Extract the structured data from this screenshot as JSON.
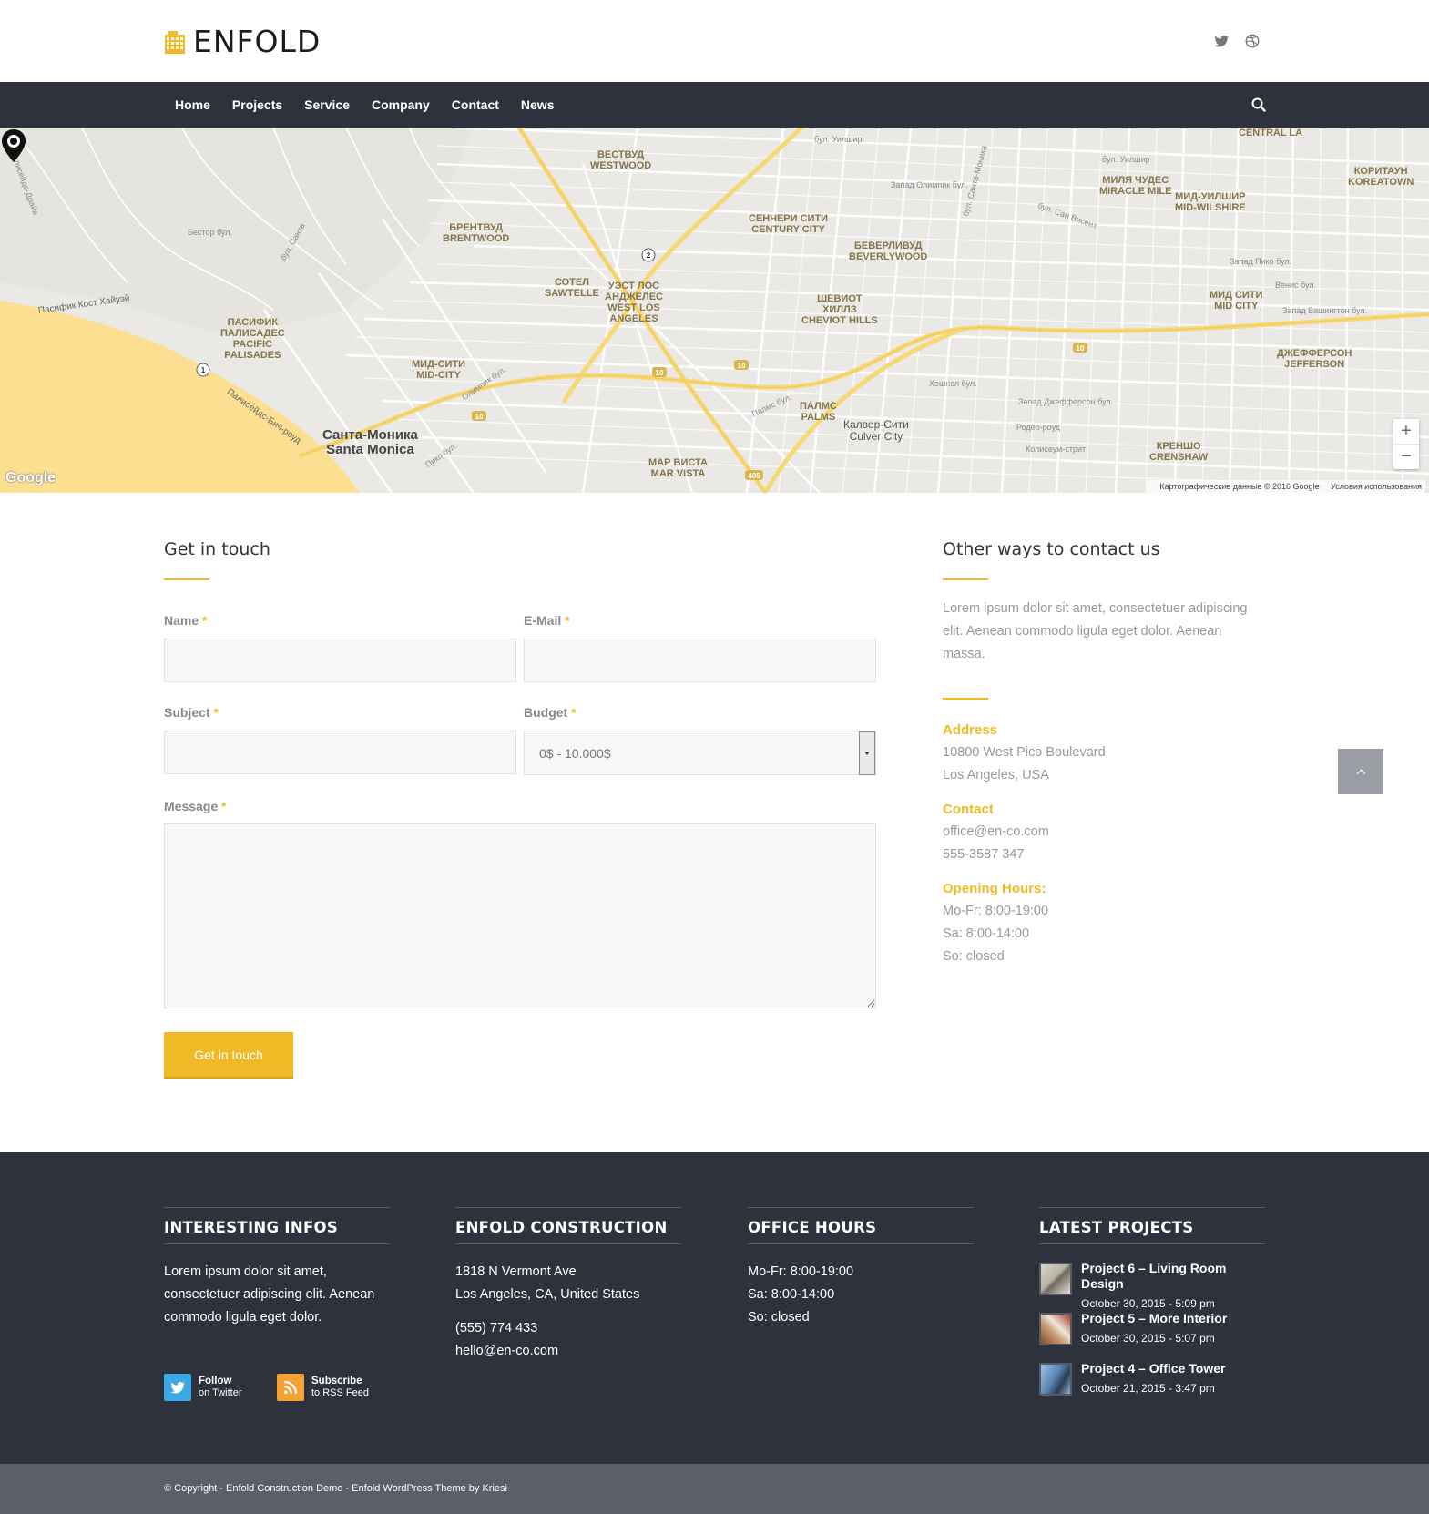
{
  "header": {
    "logo_text": "ENFOLD",
    "social": [
      "twitter-icon",
      "dribbble-icon"
    ]
  },
  "nav": {
    "items": [
      "Home",
      "Projects",
      "Service",
      "Company",
      "Contact",
      "News"
    ]
  },
  "map": {
    "labels": [
      {
        "text": "ВЕСТВУД\nWESTWOOD"
      },
      {
        "text": "БРЕНТВУД\nBRENTWOOD"
      },
      {
        "text": "СЕНЧЕРИ СИТИ\nCENTURY CITY"
      },
      {
        "text": "БЕВЕРЛИВУД\nBEVERLYWOOD"
      },
      {
        "text": "МИЛЯ ЧУДЕС\nMIRACLE MILE"
      },
      {
        "text": "МИД-УИЛШИР\nMID-WILSHIRE"
      },
      {
        "text": "КОРИТАУН\nKOREATOWN"
      },
      {
        "text": "CENTRAL LA"
      },
      {
        "text": "СОТЕЛ\nSAWTELLE"
      },
      {
        "text": "УЭСТ ЛОС\nАНДЖЕЛЕС\nWEST LOS\nANGELES"
      },
      {
        "text": "ШЕВИОТ\nХИЛЛЗ\nCHEVIOT HILLS"
      },
      {
        "text": "МИД СИТИ\nMID CITY"
      },
      {
        "text": "ПАСИФИК\nПАЛИСАДЕС\nPACIFIC\nPALISADES"
      },
      {
        "text": "МИД-СИТИ\nMID-CITY"
      },
      {
        "text": "ДЖЕФФЕРСОН\nJEFFERSON"
      },
      {
        "text": "ПАЛМС\nPALMS"
      },
      {
        "text": "КРЕНШО\nCRENSHAW"
      },
      {
        "text": "МАР ВИСТА\nMAR VISTA"
      },
      {
        "text": "Санта-Моника\nSanta Monica"
      },
      {
        "text": "Калвер-Сити\nCulver City"
      }
    ],
    "streets": [
      "Палисейдс-Драйв",
      "Пасифик Кост Хайуэй",
      "Палисейдс-Бич-роуд",
      "бул. Уилшир",
      "бул. Санта-Моника",
      "Запад Олимпик бул.",
      "бул. Уилшир",
      "бул. Сан Висент",
      "Запад Пико бул.",
      "Венис бул.",
      "Запад Вашингтон бул.",
      "Запад Джефферсон бул.",
      "Родео-роуд",
      "Колисеум-стрит",
      "Хешнел бул.",
      "Палмс бул.",
      "бул. Санта",
      "Олимпик бул.",
      "Бестор бул.",
      "Пико бул."
    ],
    "google": "Google",
    "attribution": "Картографические данные © 2016 Google",
    "terms": "Условия использования",
    "zoom_in": "+",
    "zoom_out": "−",
    "colors": {
      "freeway": "#f9e08a",
      "water": "#fddf92",
      "land": "#ebe9e5",
      "road": "#ffffff"
    }
  },
  "form": {
    "title": "Get in touch",
    "name_label": "Name",
    "email_label": "E-Mail",
    "subject_label": "Subject",
    "budget_label": "Budget",
    "message_label": "Message",
    "required_mark": "*",
    "budget_value": "0$ - 10.000$",
    "submit_label": "Get in touch"
  },
  "contact_info": {
    "title": "Other ways to contact us",
    "intro": "Lorem ipsum dolor sit amet, consectetuer adipiscing elit. Aenean commodo ligula eget dolor. Aenean massa.",
    "address_head": "Address",
    "address_lines": [
      "10800 West Pico Boulevard",
      "Los Angeles, USA"
    ],
    "contact_head": "Contact",
    "contact_lines": [
      "office@en-co.com",
      "555-3587 347"
    ],
    "hours_head": "Opening Hours:",
    "hours_lines": [
      "Mo-Fr: 8:00-19:00",
      "Sa: 8:00-14:00",
      "So: closed"
    ]
  },
  "footer": {
    "col1": {
      "title": "INTERESTING INFOS",
      "text": "Lorem ipsum dolor sit amet, consectetuer adipiscing elit. Aenean commodo ligula eget dolor.",
      "follow_label": "Follow",
      "follow_sub": "on Twitter",
      "subscribe_label": "Subscribe",
      "subscribe_sub": "to RSS Feed"
    },
    "col2": {
      "title": "ENFOLD CONSTRUCTION",
      "lines": [
        "1818 N Vermont Ave",
        "Los Angeles, CA, United States"
      ],
      "lines2": [
        "(555) 774 433",
        "hello@en-co.com"
      ]
    },
    "col3": {
      "title": "OFFICE HOURS",
      "lines": [
        "Mo-Fr: 8:00-19:00",
        "Sa: 8:00-14:00",
        "So: closed"
      ]
    },
    "col4": {
      "title": "LATEST PROJECTS",
      "projects": [
        {
          "title": "Project 6 – Living Room Design",
          "date": "October 30, 2015 - 5:09 pm"
        },
        {
          "title": "Project 5 – More Interior",
          "date": "October 30, 2015 - 5:07 pm"
        },
        {
          "title": "Project 4 – Office Tower",
          "date": "October 21, 2015 - 3:47 pm"
        }
      ]
    },
    "copyright": "© Copyright - Enfold Construction Demo - Enfold WordPress Theme by Kriesi"
  },
  "colors": {
    "accent": "#f0ba27",
    "nav_bg": "#2d323c",
    "socket_bg": "#5a5f68",
    "twitter": "#3aa9e6",
    "rss": "#f6a131"
  }
}
